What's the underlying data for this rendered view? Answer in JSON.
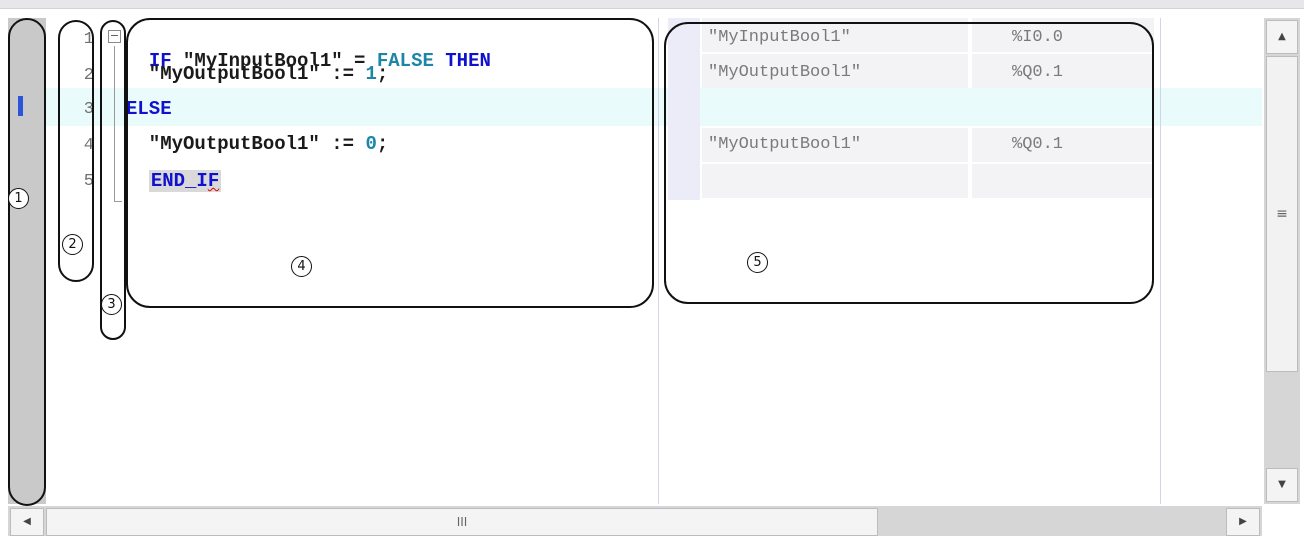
{
  "editor": {
    "lines": [
      {
        "number": "1",
        "parts": [
          {
            "text": "IF",
            "style": "kw"
          },
          {
            "text": " \"MyInputBool1\" = ",
            "style": "plain"
          },
          {
            "text": "FALSE",
            "style": "cnt"
          },
          {
            "text": " ",
            "style": "plain"
          },
          {
            "text": "THEN",
            "style": "kw"
          }
        ]
      },
      {
        "number": "2",
        "parts": [
          {
            "text": "  \"MyOutputBool1\" := ",
            "style": "plain"
          },
          {
            "text": "1",
            "style": "cnt"
          },
          {
            "text": ";",
            "style": "plain"
          }
        ]
      },
      {
        "number": "3",
        "parts": [
          {
            "text": "ELSE",
            "style": "kw"
          }
        ]
      },
      {
        "number": "4",
        "parts": [
          {
            "text": "  \"MyOutputBool1\" := ",
            "style": "plain"
          },
          {
            "text": "0",
            "style": "cnt"
          },
          {
            "text": ";",
            "style": "plain"
          }
        ]
      },
      {
        "number": "5",
        "parts": [
          {
            "text": "  ",
            "style": "plain"
          },
          {
            "text": "END_IF",
            "style": "kw endif"
          }
        ]
      }
    ],
    "end_if_err": "F",
    "fold_symbol": "−",
    "highlighted_line": 3
  },
  "xref": {
    "rows": [
      {
        "tag": "\"MyInputBool1\"",
        "address": "%I0.0"
      },
      {
        "tag": "\"MyOutputBool1\"",
        "address": "%Q0.1"
      },
      {
        "tag": "",
        "address": ""
      },
      {
        "tag": "\"MyOutputBool1\"",
        "address": "%Q0.1"
      },
      {
        "tag": "",
        "address": ""
      }
    ]
  },
  "callouts": [
    "1",
    "2",
    "3",
    "4",
    "5"
  ],
  "scrollbars": {
    "up_arrow": "▲",
    "down_arrow": "▼",
    "left_arrow": "◀",
    "right_arrow": "▶",
    "v_grip": "≡",
    "h_grip": "III"
  }
}
